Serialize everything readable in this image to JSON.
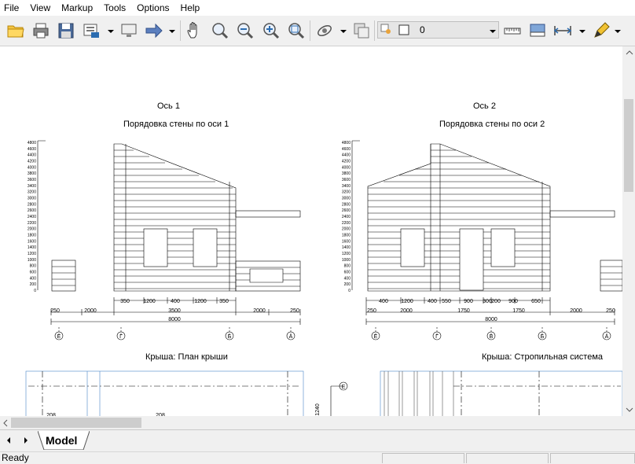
{
  "menu": [
    "File",
    "View",
    "Markup",
    "Tools",
    "Options",
    "Help"
  ],
  "toolbar": {
    "layer_value": "0",
    "icons": [
      "open-folder-icon",
      "print-icon",
      "save-icon",
      "export-icon",
      "monitor-icon",
      "arrow-right-icon",
      "pan-hand-icon",
      "zoom-realtime-icon",
      "zoom-out-icon",
      "zoom-in-icon",
      "zoom-extents-icon",
      "orbit-icon",
      "window-icon",
      "layer-state-icon",
      "measure-distance-icon",
      "measure-area-icon",
      "dimension-icon",
      "markup-pen-icon"
    ]
  },
  "drawings": {
    "left": {
      "title": "Ось 1",
      "subtitle": "Порядовка стены по оси 1",
      "y_ticks": [
        "4800",
        "4600",
        "4400",
        "4200",
        "4000",
        "3800",
        "3600",
        "3400",
        "3200",
        "3000",
        "2800",
        "2600",
        "2400",
        "2200",
        "2000",
        "1800",
        "1600",
        "1400",
        "1200",
        "1000",
        "800",
        "600",
        "400",
        "200",
        "0"
      ],
      "top_dims": [
        "350",
        "1200",
        "400",
        "1200",
        "350"
      ],
      "mid_dims": [
        "250",
        "2000",
        "3500",
        "2000",
        "250"
      ],
      "total": "8000",
      "axes": [
        "Е",
        "Г",
        "Б",
        "А"
      ]
    },
    "right": {
      "title": "Ось 2",
      "subtitle": "Порядовка стены по оси 2",
      "y_ticks": [
        "4800",
        "4600",
        "4400",
        "4200",
        "4000",
        "3800",
        "3600",
        "3400",
        "3200",
        "3000",
        "2800",
        "2600",
        "2400",
        "2200",
        "2000",
        "1800",
        "1600",
        "1400",
        "1200",
        "1000",
        "800",
        "600",
        "400",
        "200",
        "0"
      ],
      "top_dims": [
        "400",
        "1200",
        "400",
        "550",
        "900",
        "300",
        "200",
        "900",
        "650"
      ],
      "mid_dims": [
        "250",
        "2000",
        "1750",
        "1750",
        "2000",
        "250"
      ],
      "total": "8000",
      "axes": [
        "Е",
        "Г",
        "В",
        "Б",
        "А"
      ]
    },
    "roof_plan_title": "Крыша: План крыши",
    "rafter_title": "Крыша: Стропильная система",
    "roof_labels": [
      "208",
      "208"
    ],
    "roof_dim": "1240",
    "roof_axis": "Е"
  },
  "tabs": {
    "model": "Model"
  },
  "status": {
    "text": "Ready"
  }
}
